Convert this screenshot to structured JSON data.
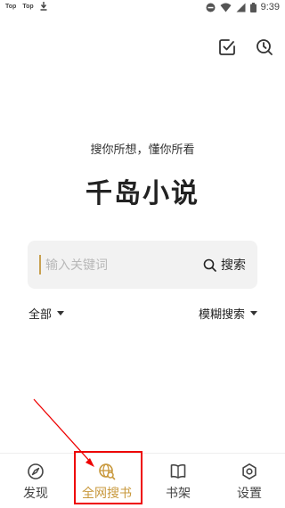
{
  "status_bar": {
    "notifications": [
      "Top",
      "Top"
    ],
    "time": "9:39"
  },
  "header": {
    "actions": [
      {
        "name": "checkin-icon"
      },
      {
        "name": "history-clock-icon"
      }
    ]
  },
  "main": {
    "slogan": "搜你所想，懂你所看",
    "title": "千岛小说",
    "search": {
      "placeholder": "输入关键词",
      "button_label": "搜索"
    },
    "filter_scope": "全部",
    "filter_mode": "模糊搜索"
  },
  "bottom_nav": {
    "items": [
      {
        "label": "发现",
        "icon": "compass-icon",
        "active": false
      },
      {
        "label": "全网搜书",
        "icon": "globe-search-icon",
        "active": true
      },
      {
        "label": "书架",
        "icon": "book-icon",
        "active": false
      },
      {
        "label": "设置",
        "icon": "gear-icon",
        "active": false
      }
    ]
  },
  "colors": {
    "accent": "#c8983c",
    "annotation": "#ee0000"
  }
}
